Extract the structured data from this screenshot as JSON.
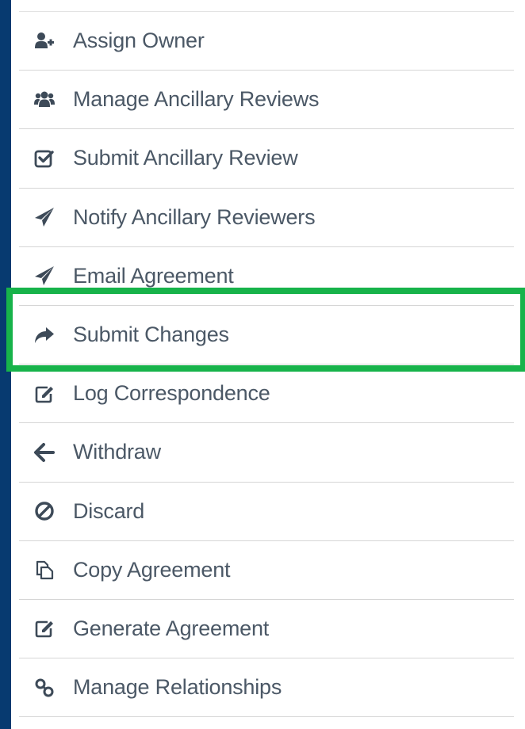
{
  "menu": {
    "items": [
      {
        "label": "Assign Owner",
        "icon": "user-plus-icon"
      },
      {
        "label": "Manage Ancillary Reviews",
        "icon": "users-icon"
      },
      {
        "label": "Submit Ancillary Review",
        "icon": "check-square-icon"
      },
      {
        "label": "Notify Ancillary Reviewers",
        "icon": "paper-plane-icon"
      },
      {
        "label": "Email Agreement",
        "icon": "paper-plane-icon"
      },
      {
        "label": "Submit Changes",
        "icon": "share-arrow-icon",
        "highlighted": true
      },
      {
        "label": "Log Correspondence",
        "icon": "edit-icon"
      },
      {
        "label": "Withdraw",
        "icon": "arrow-left-icon"
      },
      {
        "label": "Discard",
        "icon": "ban-icon"
      },
      {
        "label": "Copy Agreement",
        "icon": "copy-icon"
      },
      {
        "label": "Generate Agreement",
        "icon": "edit-icon"
      },
      {
        "label": "Manage Relationships",
        "icon": "link-icon"
      }
    ]
  },
  "colors": {
    "background": "#073a70",
    "panel": "#ffffff",
    "text": "#4b5866",
    "icon": "#3d4a58",
    "highlight": "#17b34a"
  }
}
